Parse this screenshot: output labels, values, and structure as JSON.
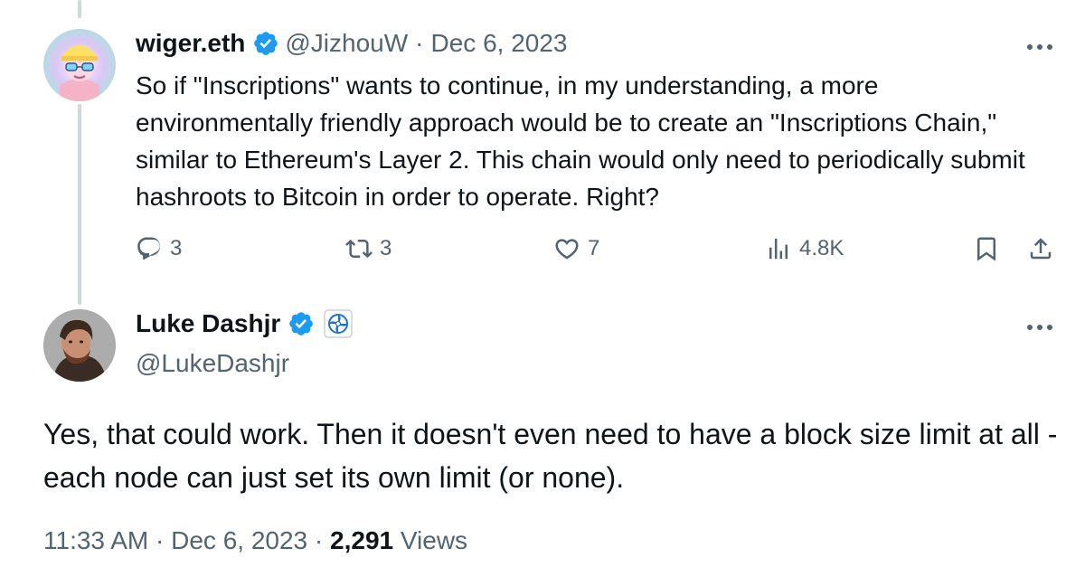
{
  "tweet1": {
    "name": "wiger.eth",
    "handle": "@JizhouW",
    "separator": "·",
    "date": "Dec 6, 2023",
    "text": "So if \"Inscriptions\" wants to continue, in my understanding, a more environmentally friendly approach would be to create an \"Inscriptions Chain,\" similar to Ethereum's Layer 2. This chain would only need to periodically submit hashroots to Bitcoin in order to operate. Right?",
    "replies": "3",
    "reposts": "3",
    "likes": "7",
    "views": "4.8K",
    "icons": [
      "verified-badge-icon",
      "more-icon",
      "reply-icon",
      "repost-icon",
      "like-icon",
      "views-icon",
      "bookmark-icon",
      "share-icon"
    ]
  },
  "tweet2": {
    "name": "Luke Dashjr",
    "handle": "@LukeDashjr",
    "text": "Yes, that could work. Then it doesn't even need to have a block size limit at all - each node can just set its own limit (or none).",
    "time": "11:33 AM",
    "separator": "·",
    "date": "Dec 6, 2023",
    "separator2": "·",
    "views_count": "2,291",
    "views_label": "Views",
    "icons": [
      "verified-badge-icon",
      "affiliation-badge-icon",
      "more-icon"
    ]
  },
  "colors": {
    "text_primary": "#0f1419",
    "text_secondary": "#536471",
    "verified_blue": "#1d9bf0",
    "thread_line": "#cfd9de"
  }
}
